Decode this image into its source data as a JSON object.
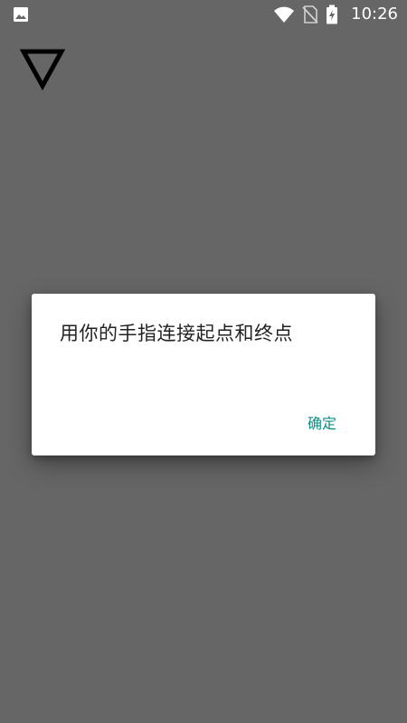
{
  "status_bar": {
    "time": "10:26",
    "icons": [
      "image-notification-icon",
      "wifi-icon",
      "no-sim-icon",
      "battery-charging-icon"
    ]
  },
  "logo": {
    "icon": "down-triangle-logo-icon"
  },
  "dialog": {
    "message": "用你的手指连接起点和终点",
    "confirm_label": "确定"
  },
  "colors": {
    "background": "#666666",
    "dialog_bg": "#ffffff",
    "accent": "#0a8f84",
    "text": "#222222"
  }
}
